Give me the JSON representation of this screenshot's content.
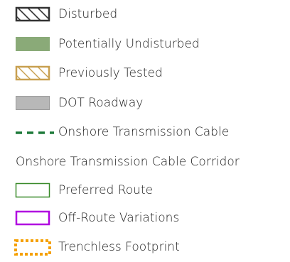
{
  "legend": {
    "items": [
      {
        "label": "Disturbed",
        "symbol": "hatch-box",
        "stroke": "#333333"
      },
      {
        "label": "Potentially Undisturbed",
        "symbol": "filled-box",
        "fill": "#8aaa78"
      },
      {
        "label": "Previously Tested",
        "symbol": "hatch-box",
        "stroke": "#c8a050"
      },
      {
        "label": "DOT Roadway",
        "symbol": "filled-box",
        "fill": "#b8b8b8",
        "stroke": "#9a9a9a"
      },
      {
        "label": "Onshore Transmission Cable",
        "symbol": "dashed-line",
        "stroke": "#1e7a3a"
      },
      {
        "label": "Onshore Transmission Cable Corridor",
        "symbol": "heading"
      },
      {
        "label": "Preferred Route",
        "symbol": "outline-box",
        "stroke": "#3a8a2a"
      },
      {
        "label": "Off-Route Variations",
        "symbol": "outline-box",
        "stroke": "#b000e0"
      },
      {
        "label": "Trenchless Footprint",
        "symbol": "dotted-box",
        "stroke": "#f5a000"
      }
    ]
  }
}
